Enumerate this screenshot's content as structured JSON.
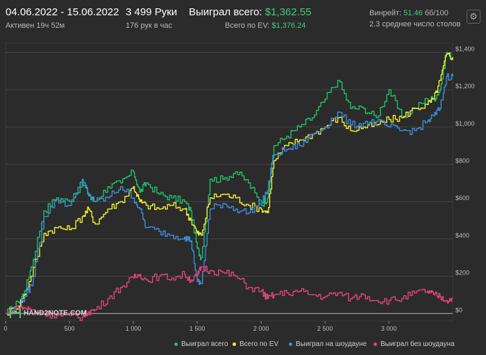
{
  "header": {
    "date_range": "04.06.2022 - 15.06.2022",
    "active_time": "Активен 19ч 52м",
    "hands": "3 499 Руки",
    "hands_per_hour": "176 рук в час",
    "won_total_label": "Выиграл всего:",
    "won_total_value": "$1,362.55",
    "ev_label": "Всего по EV:",
    "ev_value": "$1,376.24",
    "winrate_label": "Винрейт:",
    "winrate_value": "51.46",
    "winrate_suffix": "бб/100",
    "tables": "2.3 среднее число столов"
  },
  "icons": {
    "settings": "gear-icon",
    "logo": "hand2note-logo"
  },
  "logo_text": "HAND2NOTE.COM",
  "colors": {
    "background": "#2b2b2b",
    "grid": "#4a4a4a",
    "accent_green": "#3fcf79",
    "won_total": "#22c26d",
    "ev": "#f2f230",
    "showdown": "#3d8fdc",
    "non_showdown": "#e0447a"
  },
  "chart_data": {
    "type": "line",
    "xlabel": "",
    "ylabel": "",
    "xlim": [
      0,
      3499
    ],
    "ylim": [
      -40,
      1450
    ],
    "x_ticks": [
      0,
      500,
      1000,
      1500,
      2000,
      2500,
      3000
    ],
    "x_tick_labels": [
      "0",
      "500",
      "1 000",
      "1 500",
      "2 000",
      "2 500",
      "3 000"
    ],
    "y_ticks": [
      0,
      200,
      400,
      600,
      800,
      1000,
      1200,
      1400
    ],
    "y_tick_labels": [
      "$0",
      "$200",
      "$400",
      "$600",
      "$800",
      "$1,000",
      "$1,200",
      "$1,400"
    ],
    "grid": true,
    "legend_position": "bottom-right",
    "series": [
      {
        "name": "Выиграл всего",
        "color": "#22c26d",
        "x": [
          0,
          100,
          150,
          200,
          300,
          400,
          500,
          600,
          650,
          700,
          800,
          900,
          1000,
          1050,
          1100,
          1200,
          1300,
          1400,
          1450,
          1500,
          1530,
          1600,
          1700,
          1800,
          1900,
          2000,
          2050,
          2100,
          2200,
          2300,
          2400,
          2500,
          2600,
          2700,
          2800,
          2900,
          3000,
          3100,
          3200,
          3300,
          3350,
          3400,
          3450,
          3499
        ],
        "y": [
          0,
          60,
          120,
          250,
          550,
          620,
          600,
          700,
          640,
          600,
          680,
          700,
          760,
          650,
          700,
          640,
          620,
          600,
          550,
          350,
          300,
          720,
          720,
          760,
          700,
          580,
          620,
          900,
          950,
          1000,
          1050,
          1150,
          1250,
          1100,
          1100,
          1050,
          1200,
          1050,
          1100,
          1150,
          1150,
          1200,
          1400,
          1370
        ]
      },
      {
        "name": "Всего по EV",
        "color": "#f2f230",
        "x": [
          0,
          100,
          150,
          200,
          300,
          400,
          500,
          600,
          650,
          700,
          800,
          900,
          1000,
          1050,
          1100,
          1200,
          1300,
          1400,
          1450,
          1500,
          1530,
          1600,
          1700,
          1800,
          1900,
          2000,
          2050,
          2100,
          2200,
          2300,
          2400,
          2500,
          2600,
          2700,
          2800,
          2900,
          3000,
          3100,
          3200,
          3300,
          3350,
          3400,
          3450,
          3499
        ],
        "y": [
          0,
          40,
          100,
          200,
          430,
          460,
          450,
          520,
          560,
          480,
          560,
          600,
          680,
          600,
          580,
          560,
          580,
          560,
          500,
          430,
          420,
          620,
          640,
          620,
          580,
          560,
          540,
          820,
          900,
          930,
          960,
          1000,
          1050,
          980,
          1000,
          1010,
          1040,
          1050,
          1100,
          1120,
          1150,
          1250,
          1390,
          1375
        ]
      },
      {
        "name": "Выиграл на шоудауне",
        "color": "#3d8fdc",
        "x": [
          0,
          100,
          150,
          200,
          300,
          400,
          500,
          600,
          650,
          700,
          800,
          900,
          1000,
          1050,
          1100,
          1200,
          1300,
          1400,
          1450,
          1500,
          1530,
          1600,
          1700,
          1800,
          1900,
          2000,
          2050,
          2100,
          2200,
          2300,
          2400,
          2500,
          2600,
          2700,
          2800,
          2900,
          3000,
          3100,
          3200,
          3300,
          3350,
          3400,
          3450,
          3499
        ],
        "y": [
          0,
          30,
          90,
          150,
          520,
          610,
          580,
          720,
          630,
          600,
          620,
          680,
          620,
          560,
          460,
          440,
          420,
          410,
          390,
          170,
          160,
          560,
          590,
          560,
          540,
          600,
          660,
          850,
          880,
          900,
          960,
          1000,
          1080,
          1010,
          1020,
          1030,
          1000,
          980,
          980,
          1030,
          1060,
          1100,
          1270,
          1270
        ]
      },
      {
        "name": "Выиграл без шоудауна",
        "color": "#e0447a",
        "x": [
          0,
          100,
          150,
          200,
          300,
          400,
          500,
          600,
          650,
          700,
          800,
          900,
          1000,
          1050,
          1100,
          1200,
          1300,
          1400,
          1450,
          1500,
          1530,
          1600,
          1700,
          1800,
          1900,
          2000,
          2050,
          2100,
          2200,
          2300,
          2400,
          2500,
          2600,
          2700,
          2800,
          2900,
          3000,
          3100,
          3200,
          3300,
          3350,
          3400,
          3450,
          3499
        ],
        "y": [
          0,
          30,
          30,
          20,
          0,
          -10,
          -10,
          -20,
          10,
          20,
          80,
          140,
          190,
          210,
          180,
          200,
          190,
          210,
          180,
          200,
          250,
          230,
          220,
          200,
          140,
          120,
          80,
          100,
          110,
          120,
          100,
          90,
          110,
          80,
          100,
          70,
          70,
          80,
          110,
          120,
          100,
          90,
          70,
          80
        ]
      }
    ]
  }
}
